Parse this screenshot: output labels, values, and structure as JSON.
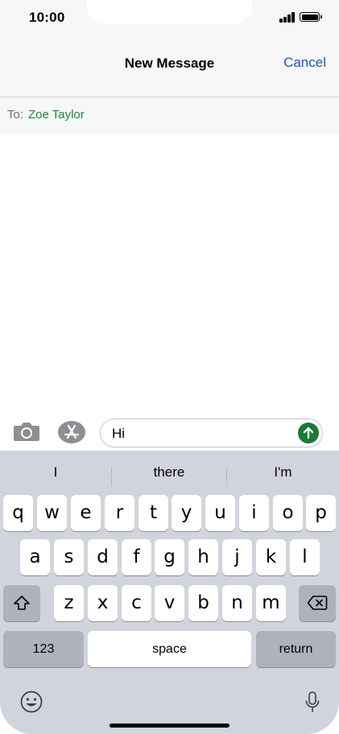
{
  "status_bar": {
    "time": "10:00"
  },
  "header": {
    "title": "New Message",
    "cancel_label": "Cancel"
  },
  "recipient": {
    "label": "To:",
    "name": "Zoe Taylor"
  },
  "composer": {
    "text": "Hi"
  },
  "keyboard": {
    "predictions": [
      "I",
      "there",
      "I'm"
    ],
    "row1": [
      "q",
      "w",
      "e",
      "r",
      "t",
      "y",
      "u",
      "i",
      "o",
      "p"
    ],
    "row2": [
      "a",
      "s",
      "d",
      "f",
      "g",
      "h",
      "j",
      "k",
      "l"
    ],
    "row3": [
      "z",
      "x",
      "c",
      "v",
      "b",
      "n",
      "m"
    ],
    "numbers_label": "123",
    "space_label": "space",
    "return_label": "return"
  },
  "icons": {
    "camera": "camera-icon",
    "apps": "app-store-icon",
    "send": "arrow-up-icon",
    "shift": "shift-icon",
    "delete": "delete-icon",
    "emoji": "emoji-icon",
    "mic": "microphone-icon"
  },
  "colors": {
    "accent_blue": "#1f56b8",
    "recipient_green": "#1f8a36",
    "send_green": "#1a7a37",
    "keyboard_bg": "#d1d4dc"
  }
}
